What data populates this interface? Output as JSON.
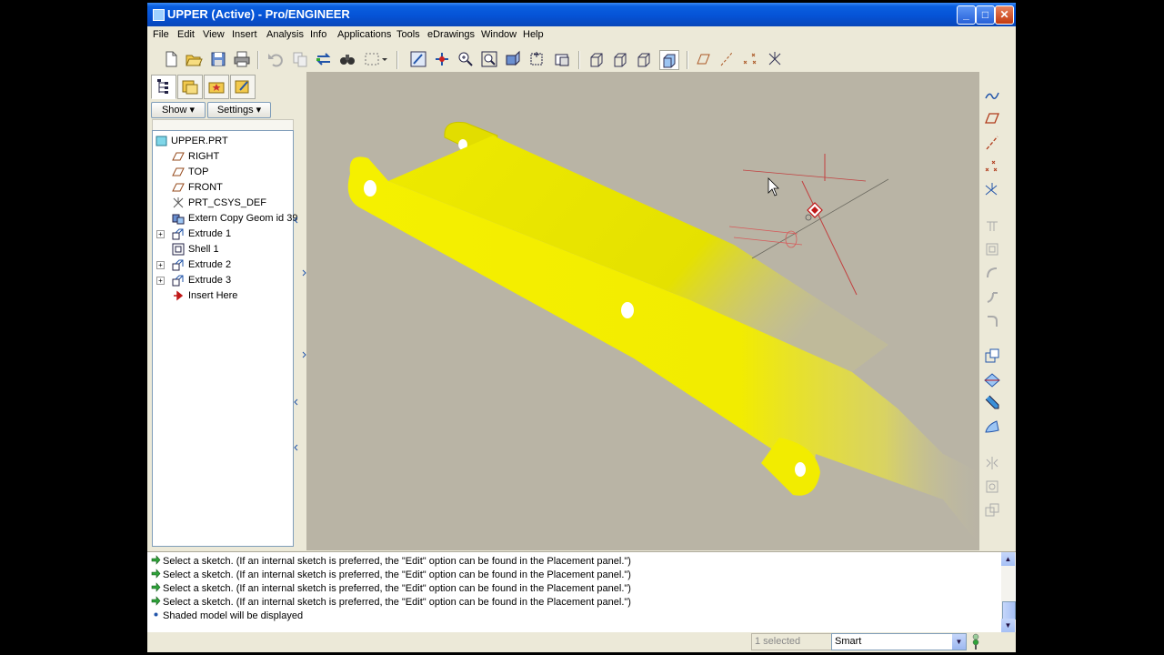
{
  "window": {
    "title": "UPPER (Active) - Pro/ENGINEER",
    "controls": {
      "minimize": "_",
      "maximize": "□",
      "close": "✕"
    }
  },
  "menu": [
    "File",
    "Edit",
    "View",
    "Insert",
    "Analysis",
    "Info",
    "Applications",
    "Tools",
    "eDrawings",
    "Window",
    "Help"
  ],
  "toolbar": {
    "icons": [
      "new-file-icon",
      "open-file-icon",
      "save-icon",
      "print-icon",
      "undo-icon",
      "copy-icon",
      "paste-icon",
      "regenerate-icon",
      "find-icon",
      "select-box-icon",
      "repaint-icon",
      "spin-center-icon",
      "zoom-in-icon",
      "zoom-fit-icon",
      "reorient-icon",
      "saved-views-icon",
      "layers-icon",
      "wireframe-icon",
      "hidden-line-icon",
      "no-hidden-icon",
      "shading-icon",
      "datum-planes-icon",
      "datum-axes-icon",
      "datum-points-icon",
      "coordinate-systems-icon"
    ]
  },
  "navigator": {
    "show_button": "Show ▾",
    "settings_button": "Settings ▾",
    "tree": [
      {
        "label": "UPPER.PRT",
        "icon": "part-icon",
        "expandable": false,
        "indent": 0
      },
      {
        "label": "RIGHT",
        "icon": "datum-plane-icon",
        "expandable": false,
        "indent": 1
      },
      {
        "label": "TOP",
        "icon": "datum-plane-icon",
        "expandable": false,
        "indent": 1
      },
      {
        "label": "FRONT",
        "icon": "datum-plane-icon",
        "expandable": false,
        "indent": 1
      },
      {
        "label": "PRT_CSYS_DEF",
        "icon": "csys-icon",
        "expandable": false,
        "indent": 1
      },
      {
        "label": "Extern Copy Geom id 39",
        "icon": "copy-geom-icon",
        "expandable": false,
        "indent": 1
      },
      {
        "label": "Extrude 1",
        "icon": "extrude-icon",
        "expandable": true,
        "indent": 1
      },
      {
        "label": "Shell 1",
        "icon": "shell-icon",
        "expandable": false,
        "indent": 1
      },
      {
        "label": "Extrude 2",
        "icon": "extrude-icon",
        "expandable": true,
        "indent": 1
      },
      {
        "label": "Extrude 3",
        "icon": "extrude-icon",
        "expandable": true,
        "indent": 1
      },
      {
        "label": "Insert Here",
        "icon": "insert-arrow-icon",
        "expandable": false,
        "indent": 1
      }
    ]
  },
  "viewport": {
    "background": "#b9b4a5",
    "model_color": "#f5f000"
  },
  "right_toolbar": {
    "icons": [
      "sketch-tool-icon",
      "datum-plane-tool-icon",
      "datum-axis-tool-icon",
      "datum-point-tool-icon",
      "csys-tool-icon",
      "extrude-tool-icon",
      "revolve-tool-icon",
      "sweep-tool-icon",
      "blend-tool-icon",
      "round-tool-icon",
      "hole-tool-icon",
      "shell-tool-icon",
      "rib-tool-icon",
      "draft-tool-icon",
      "mirror-tool-icon",
      "pattern-tool-icon",
      "copy-tool-icon"
    ]
  },
  "messages": [
    {
      "type": "prompt",
      "text": "Select a sketch. (If an internal sketch is preferred, the \"Edit\" option can be found in the Placement panel.\")"
    },
    {
      "type": "prompt",
      "text": "Select a sketch. (If an internal sketch is preferred, the \"Edit\" option can be found in the Placement panel.\")"
    },
    {
      "type": "prompt",
      "text": "Select a sketch. (If an internal sketch is preferred, the \"Edit\" option can be found in the Placement panel.\")"
    },
    {
      "type": "prompt",
      "text": "Select a sketch. (If an internal sketch is preferred, the \"Edit\" option can be found in the Placement panel.\")"
    },
    {
      "type": "info",
      "text": "Shaded model will be displayed"
    }
  ],
  "status": {
    "selected": "1 selected",
    "filter": "Smart"
  }
}
